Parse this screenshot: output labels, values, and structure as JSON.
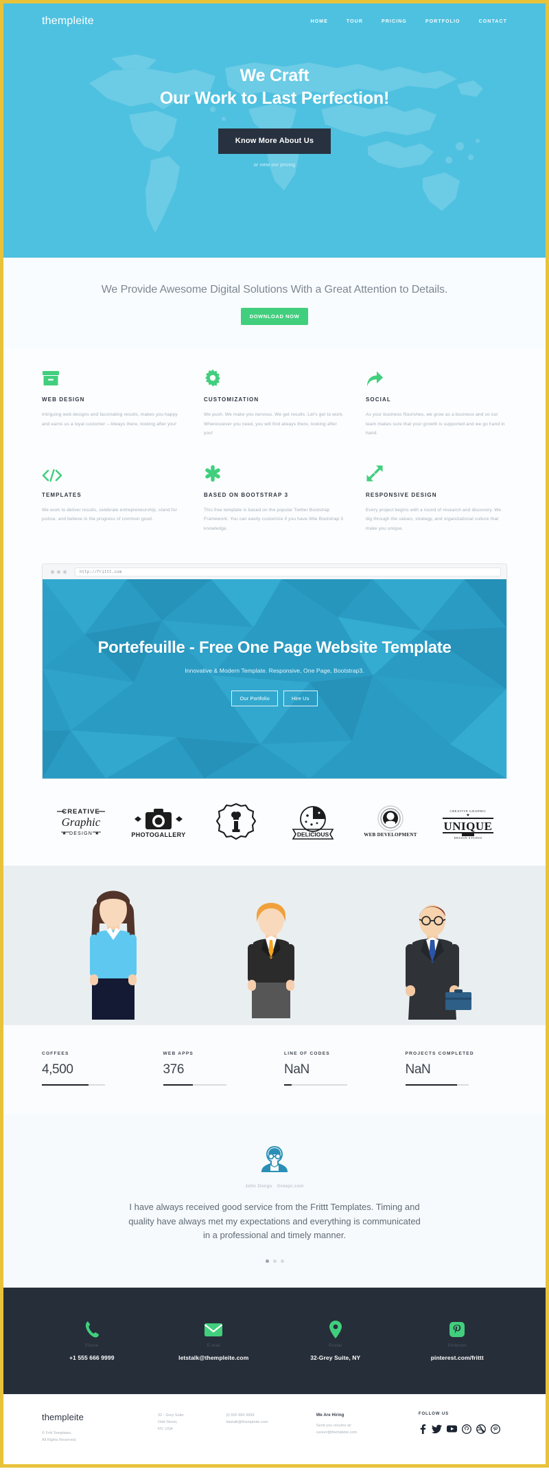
{
  "brand": "thempleite",
  "accent": {
    "sky": "#4fc1e0",
    "green": "#41cf7d",
    "dark": "#27313f",
    "yellow": "#e8c33a"
  },
  "nav": {
    "items": [
      {
        "label": "HOME"
      },
      {
        "label": "TOUR"
      },
      {
        "label": "PRICING"
      },
      {
        "label": "PORTFOLIO"
      },
      {
        "label": "CONTACT"
      }
    ]
  },
  "hero": {
    "line1": "We Craft",
    "line2": "Our Work to Last Perfection!",
    "cta": "Know More About Us",
    "subtext": "or view our pricing"
  },
  "tagline": {
    "text": "We Provide Awesome Digital Solutions With a Great Attention to Details.",
    "button": "DOWNLOAD NOW"
  },
  "features": [
    {
      "icon": "archive-box-icon",
      "title": "WEB DESIGN",
      "body": "Intriguing web designs and fascinating results, makes you happy and earns us a loyal customer – Always there, looking after you!"
    },
    {
      "icon": "gear-icon",
      "title": "CUSTOMIZATION",
      "body": "We push. We make you nervous. We get results. Let's get to work. Wheresoever you need, you will find always there, looking after you!"
    },
    {
      "icon": "share-arrow-icon",
      "title": "SOCIAL",
      "body": "As your business flourishes, we grow as a business and so our team makes sure that your growth is supported and we go hand in hand."
    },
    {
      "icon": "code-brackets-icon",
      "title": "TEMPLATES",
      "body": "We work to deliver results, celebrate entrepreneurship, stand for justice, and believe in the progress of common good."
    },
    {
      "icon": "asterisk-icon",
      "title": "BASED ON BOOTSTRAP 3",
      "body": "This free template is based on the popular Twitter Bootstrap Framework. You can easily customize if you have little Bootstrap 3 knowledge."
    },
    {
      "icon": "expand-arrows-icon",
      "title": "RESPONSIVE DESIGN",
      "body": "Every project begins with a round of research and discovery. We dig through the values, strategy, and organizational culture that make you unique."
    }
  ],
  "showcase": {
    "url": "http://frittt.com",
    "title": "Portefeuille - Free One Page Website Template",
    "subtitle": "Innovative & Modern Template. Responsive, One Page, Bootstrap3.",
    "button_primary": "Our Portfolio",
    "button_secondary": "Hire Us"
  },
  "client_logos": [
    {
      "name": "creative-graphic-design-logo",
      "top": "— CREATIVE —",
      "mid": "Graphic",
      "bottom": "★ DESIGN ★"
    },
    {
      "name": "photogallery-logo",
      "label": "PHOTOGALLERY"
    },
    {
      "name": "badge-chef-logo",
      "label": ""
    },
    {
      "name": "delicious-logo",
      "label": "DELICIOUS"
    },
    {
      "name": "web-development-logo",
      "label": "WEB DEVELOPMENT"
    },
    {
      "name": "unique-logo",
      "label": "UNIQUE"
    }
  ],
  "team": [
    {
      "name": "team-member-female-blue"
    },
    {
      "name": "team-member-female-blonde"
    },
    {
      "name": "team-member-male-suit"
    }
  ],
  "counters": [
    {
      "title": "COFFEES",
      "value": "4,500",
      "percent": 74
    },
    {
      "title": "WEB APPS",
      "value": "376",
      "percent": 47
    },
    {
      "title": "LINE OF CODES",
      "value": "NaN",
      "percent": 12
    },
    {
      "title": "PROJECTS COMPLETED",
      "value": "NaN",
      "percent": 82
    }
  ],
  "testimonial": {
    "author": "John Dongs",
    "company": "Greepr.com",
    "quote": "I have always received good service from the Frittt Templates. Timing and quality have always met my expectations and everything is communicated in a professional and timely manner.",
    "slides": 3,
    "active_slide": 1
  },
  "contact": [
    {
      "icon": "phone-icon",
      "label": "Phone",
      "value": "+1 555 666 9999"
    },
    {
      "icon": "envelope-icon",
      "label": "E-mail",
      "value": "letstalk@thempleite.com"
    },
    {
      "icon": "map-pin-icon",
      "label": "Postal",
      "value": "32-Grey Suite, NY"
    },
    {
      "icon": "pinterest-icon",
      "label": "Pinterest",
      "value": "pinterest.com/frittt"
    }
  ],
  "bottom": {
    "brand": "thempleite",
    "copyright_line1": "© Fritt Templates.",
    "copyright_line2": "All Rights Reserved.",
    "address": [
      "32 - Grey Suite",
      "Odd Street,",
      "NY, USA"
    ],
    "contact": [
      "(t) 555 666 9999",
      "letstalk@thempleite.com"
    ],
    "hiring_title": "We Are Hiring",
    "hiring_body": [
      "Send you resume at:",
      "career@thempleite.com"
    ],
    "follow_title": "FOLLOW US",
    "social": [
      "facebook-icon",
      "twitter-icon",
      "youtube-icon",
      "github-icon",
      "dribbble-icon",
      "pinterest-icon"
    ]
  }
}
